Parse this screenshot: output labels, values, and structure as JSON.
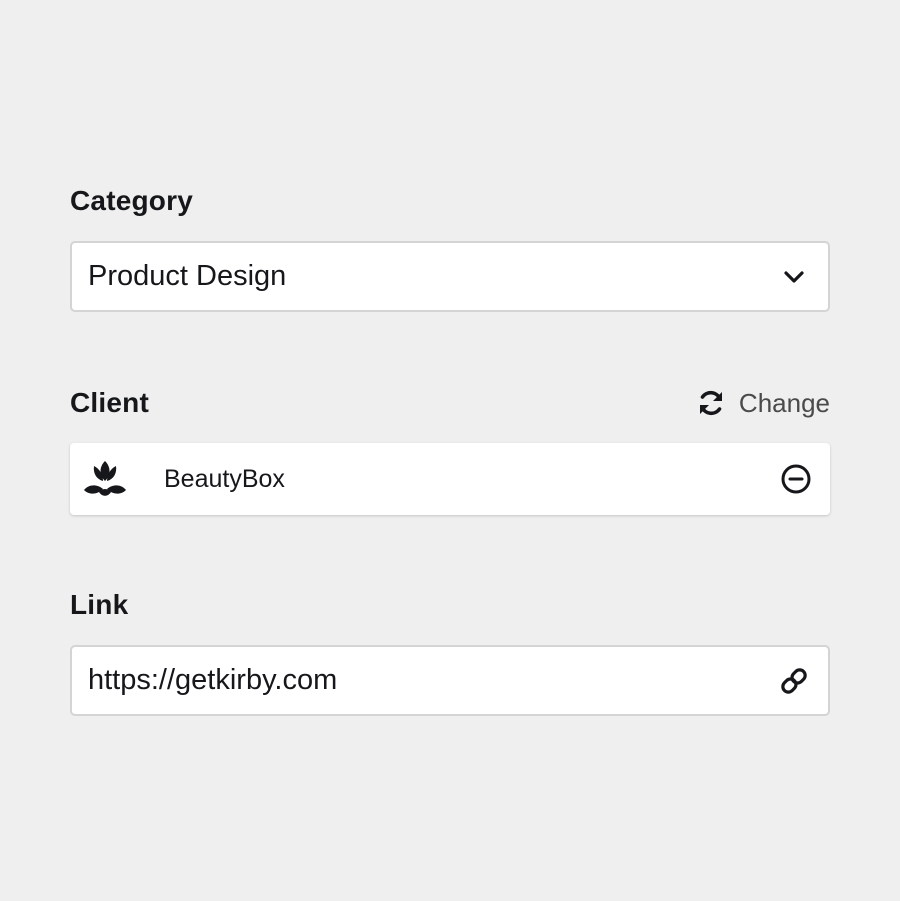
{
  "category": {
    "label": "Category",
    "selected": "Product Design",
    "icon": "chevron-down-icon"
  },
  "client": {
    "label": "Client",
    "change_label": "Change",
    "change_icon": "refresh-icon",
    "item": {
      "name": "BeautyBox",
      "logo_icon": "lotus-icon",
      "remove_icon": "remove-circle-icon"
    }
  },
  "link": {
    "label": "Link",
    "value": "https://getkirby.com",
    "icon": "link-icon"
  },
  "colors": {
    "background": "#efefef",
    "field_background": "#ffffff",
    "border": "#d4d4d4",
    "text": "#16171a",
    "muted_text": "#4a4a4a"
  }
}
